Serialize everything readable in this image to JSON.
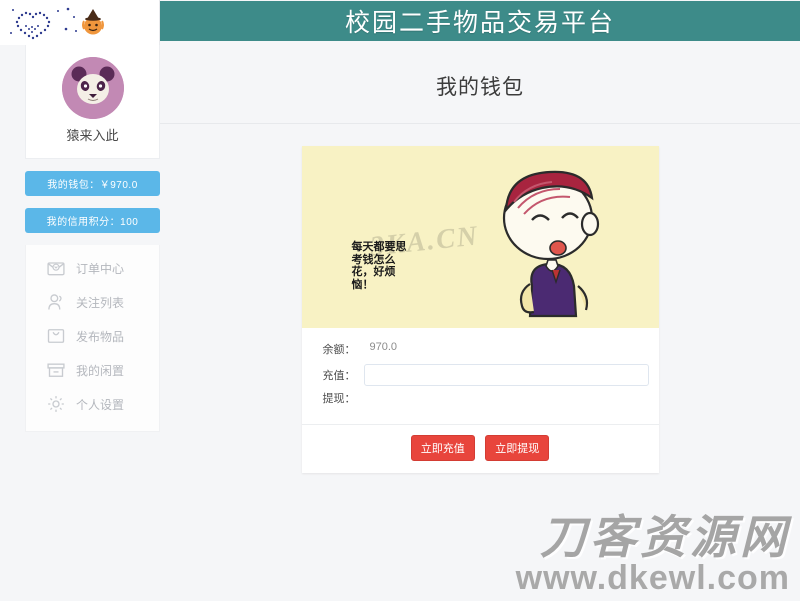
{
  "header": {
    "site_title": "校园二手物品交易平台",
    "home_icon": "home-icon",
    "decoration": {
      "heart_icon": "dotted-heart-icon",
      "pumpkin_icon": "pumpkin-witch-icon"
    }
  },
  "sidebar": {
    "avatar_icon": "panda-avatar-icon",
    "username": "猿来入此",
    "wallet_button": "我的钱包：￥970.0",
    "credit_button": "我的信用积分：100",
    "menu": [
      {
        "label": "订单中心",
        "icon": "envelope-icon"
      },
      {
        "label": "关注列表",
        "icon": "user-icon"
      },
      {
        "label": "发布物品",
        "icon": "bag-icon"
      },
      {
        "label": "我的闲置",
        "icon": "box-icon"
      },
      {
        "label": "个人设置",
        "icon": "gear-icon"
      }
    ]
  },
  "main": {
    "page_title": "我的钱包",
    "illustration": {
      "caption": "每天都要思考钱怎么花，好烦恼！",
      "watermark": "3KA.CN",
      "art": "worried-boy-illustration"
    },
    "form": {
      "balance_label": "余额：",
      "balance_value": "970.0",
      "recharge_label": "充值：",
      "recharge_value": "",
      "recharge_placeholder": "",
      "withdraw_label": "提现：",
      "withdraw_value": ""
    },
    "actions": {
      "recharge_button": "立即充值",
      "withdraw_button": "立即提现"
    }
  },
  "footer": {
    "watermark_cn": "刀客资源网",
    "watermark_url": "www.dkewl.com"
  },
  "colors": {
    "header_teal": "#3d8b89",
    "accent_blue": "#5bb7e8",
    "button_red": "#e8453c",
    "illus_yellow": "#f8f2c4",
    "page_bg": "#f5f6f8"
  }
}
